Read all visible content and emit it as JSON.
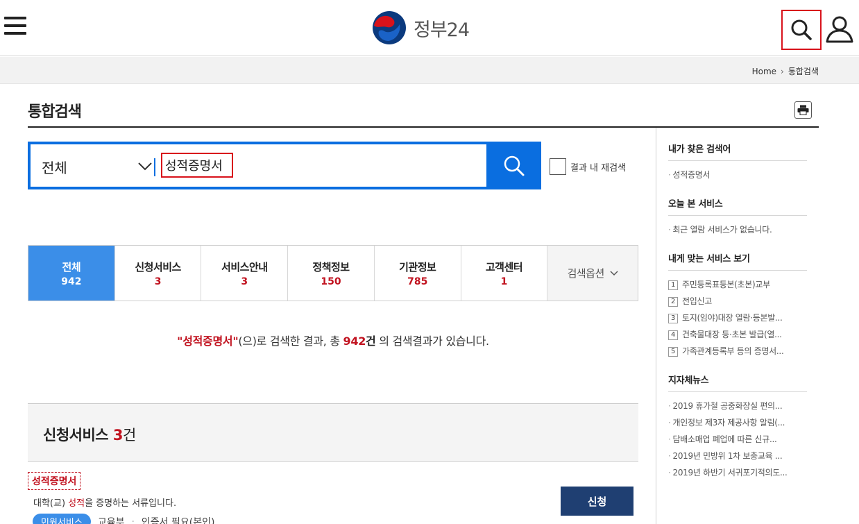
{
  "header": {
    "logo_text": "정부24",
    "menu_icon": "hamburger-menu-icon",
    "search_icon": "search-icon",
    "user_icon": "user-icon"
  },
  "breadcrumb": {
    "home": "Home",
    "current": "통합검색"
  },
  "page": {
    "title": "통합검색"
  },
  "search": {
    "category": "전체",
    "query": "성적증명서",
    "research_label": "결과 내 재검색"
  },
  "tabs": [
    {
      "label": "전체",
      "count": "942",
      "active": true
    },
    {
      "label": "신청서비스",
      "count": "3"
    },
    {
      "label": "서비스안내",
      "count": "3"
    },
    {
      "label": "정책정보",
      "count": "150"
    },
    {
      "label": "기관정보",
      "count": "785"
    },
    {
      "label": "고객센터",
      "count": "1"
    }
  ],
  "search_option_label": "검색옵션",
  "result_message": {
    "q_open": "\"",
    "keyword": "성적증명서",
    "q_close": "\"",
    "part1": "(으)로 검색한 결과, 총 ",
    "count": "942",
    "unit": "건",
    "part2": " 의 검색결과가 있습니다."
  },
  "section": {
    "title": "신청서비스",
    "count": "3",
    "unit": "건"
  },
  "result_item": {
    "title": "성적증명서",
    "desc_before": "대학(교) ",
    "desc_highlight": "성적",
    "desc_after": "을 증명하는 서류입니다.",
    "apply_label": "신청",
    "badge": "민원서비스",
    "dept": "교육부",
    "extra": "인증서 필요(본인)"
  },
  "sidebar": {
    "recent_search": {
      "title": "내가 찾은 검색어",
      "items": [
        "성적증명서"
      ]
    },
    "today_viewed": {
      "title": "오늘 본 서비스",
      "items": [
        "최근 열람 서비스가 없습니다."
      ]
    },
    "recommended": {
      "title": "내게 맞는 서비스 보기",
      "items": [
        {
          "rank": "1",
          "label": "주민등록표등본(초본)교부"
        },
        {
          "rank": "2",
          "label": "전입신고"
        },
        {
          "rank": "3",
          "label": "토지(임야)대장 열람·등본발..."
        },
        {
          "rank": "4",
          "label": "건축물대장 등·초본 발급(열..."
        },
        {
          "rank": "5",
          "label": "가족관계등록부 등의 증명서..."
        }
      ]
    },
    "local_news": {
      "title": "지자체뉴스",
      "items": [
        "2019 휴가철 공중화장실 편의...",
        "개인정보 제3자 제공사항 알림(...",
        "담배소매업 폐업에 따른 신규...",
        "2019년 민방위 1차 보충교육 ...",
        "2019년 하반기 서귀포기적의도..."
      ]
    }
  }
}
